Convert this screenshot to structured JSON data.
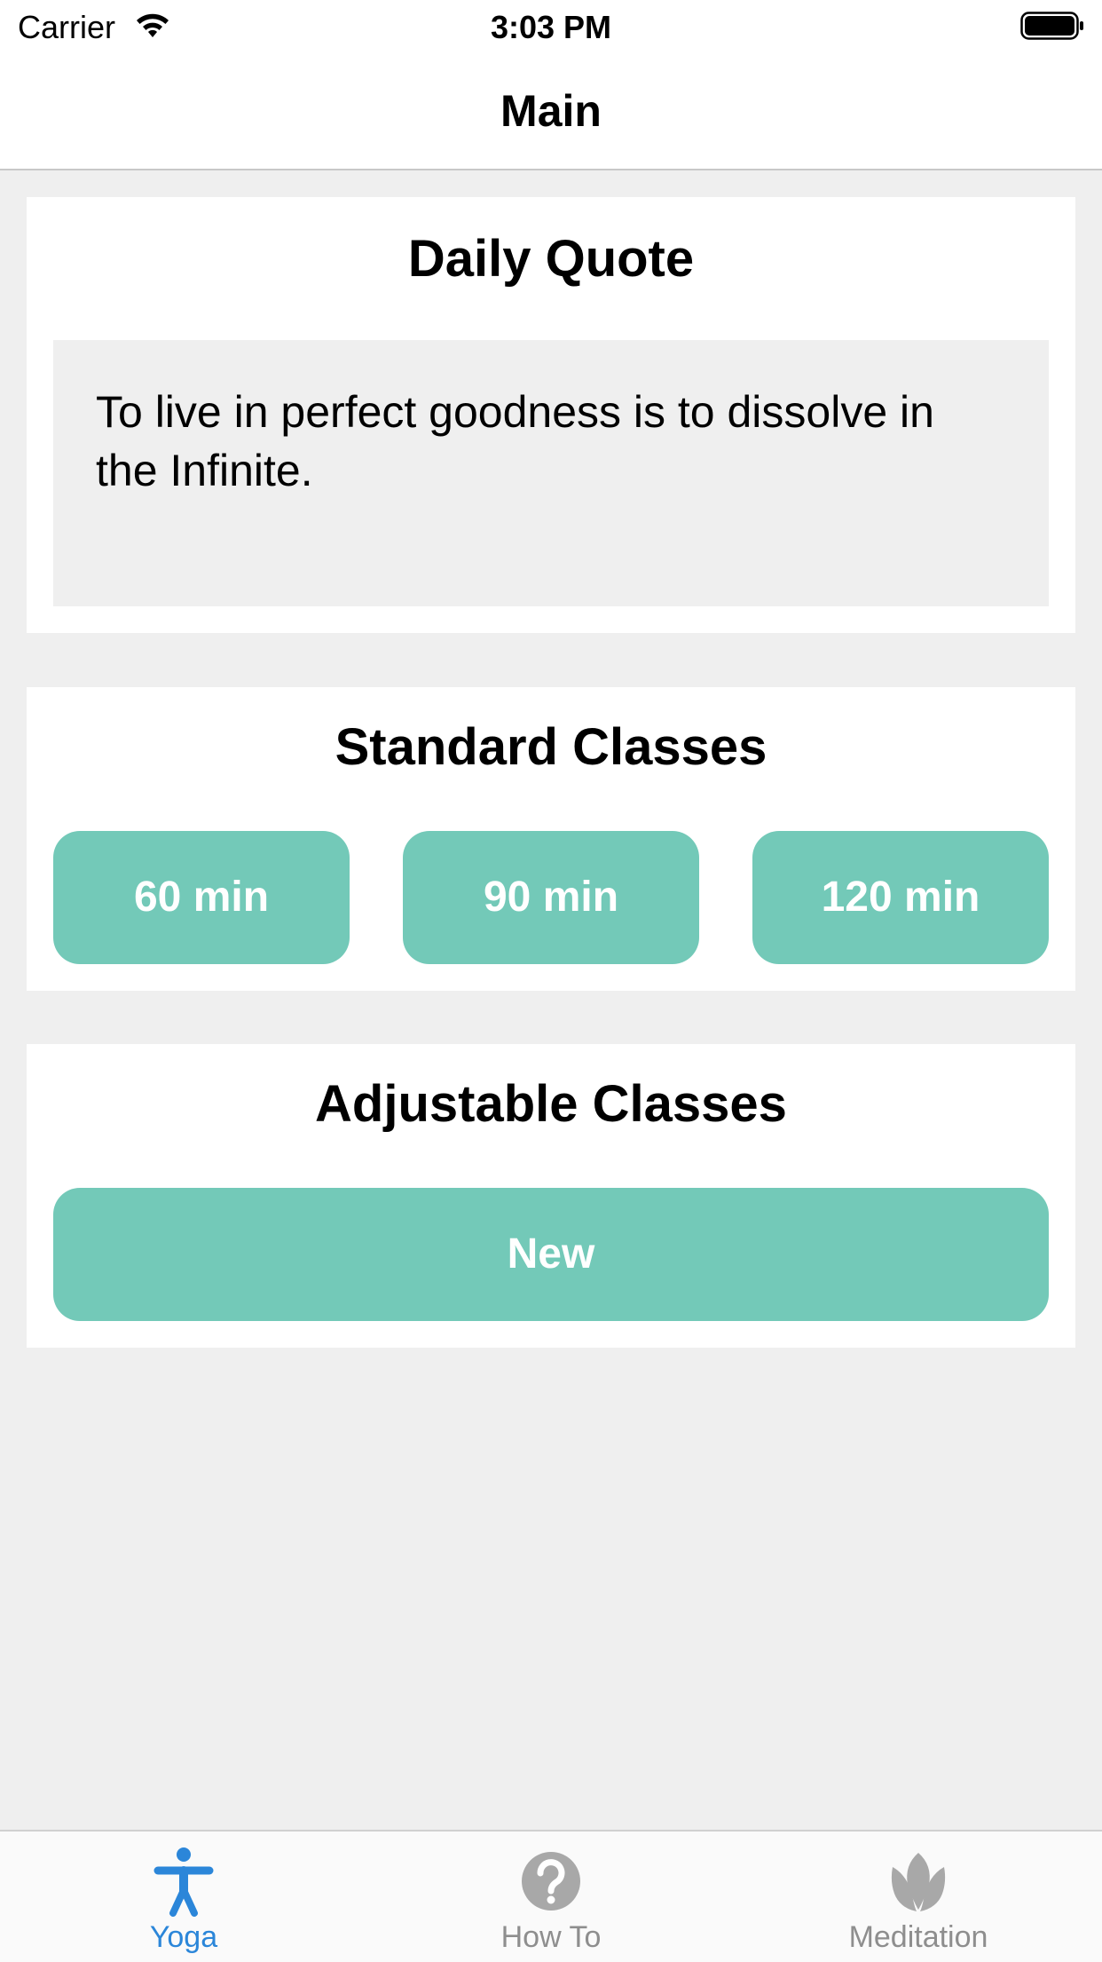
{
  "status_bar": {
    "carrier": "Carrier",
    "time": "3:03 PM"
  },
  "nav": {
    "title": "Main"
  },
  "daily_quote": {
    "title": "Daily Quote",
    "text": "To live in perfect goodness is to dissolve in the Infinite."
  },
  "standard_classes": {
    "title": "Standard Classes",
    "buttons": [
      "60 min",
      "90 min",
      "120 min"
    ]
  },
  "adjustable_classes": {
    "title": "Adjustable Classes",
    "new_label": "New"
  },
  "tab_bar": {
    "items": [
      {
        "label": "Yoga",
        "icon": "yoga-person-icon",
        "selected": true
      },
      {
        "label": "How To",
        "icon": "question-circle-icon",
        "selected": false
      },
      {
        "label": "Meditation",
        "icon": "lotus-icon",
        "selected": false
      }
    ]
  },
  "colors": {
    "accent": "#73c9b8",
    "tab_selected": "#2b86d9",
    "tab_unselected": "#8e8e8e",
    "background": "#efefef"
  }
}
